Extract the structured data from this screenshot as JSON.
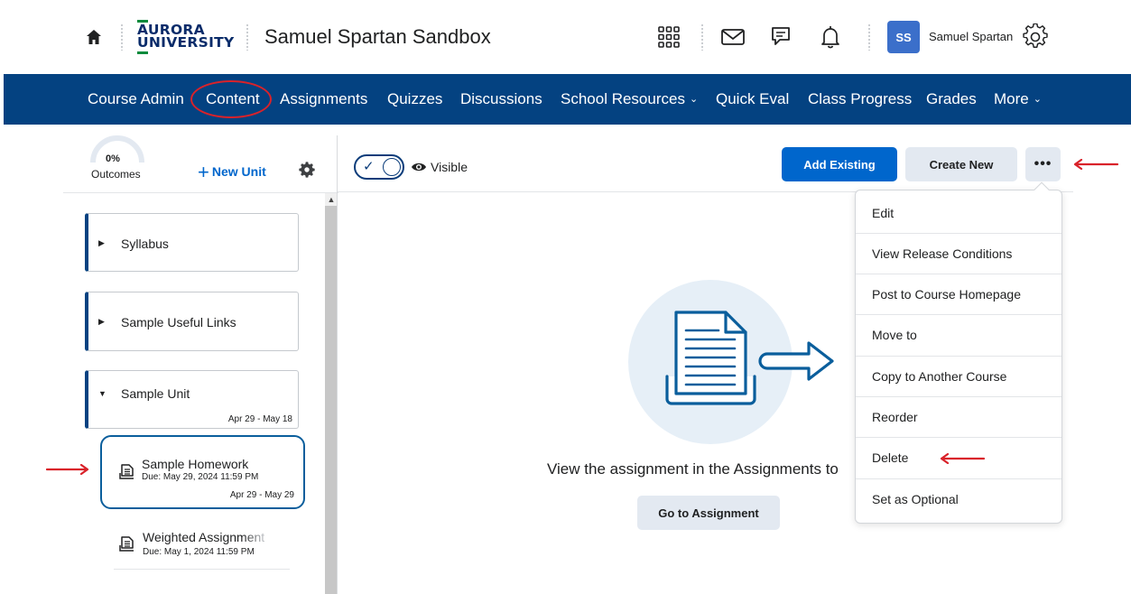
{
  "header": {
    "logo_line1": "AURORA",
    "logo_line2": "UNIVERSITY",
    "course_title": "Samuel Spartan Sandbox",
    "avatar_initials": "SS",
    "user_name": "Samuel Spartan"
  },
  "nav": {
    "items": [
      {
        "label": "Course Admin"
      },
      {
        "label": "Content"
      },
      {
        "label": "Assignments"
      },
      {
        "label": "Quizzes"
      },
      {
        "label": "Discussions"
      },
      {
        "label": "School Resources"
      },
      {
        "label": "Quick Eval"
      },
      {
        "label": "Class Progress"
      },
      {
        "label": "Grades"
      },
      {
        "label": "More"
      }
    ]
  },
  "sidebar": {
    "outcomes_percent": "0%",
    "outcomes_label": "Outcomes",
    "new_unit_label": "New Unit",
    "units": [
      {
        "title": "Syllabus",
        "dates": ""
      },
      {
        "title": "Sample Useful Links",
        "dates": ""
      },
      {
        "title": "Sample Unit",
        "dates": "Apr 29 - May 18"
      }
    ],
    "topics": [
      {
        "title": "Sample Homework",
        "due": "Due: May 29, 2024 11:59 PM",
        "dates": "Apr 29 - May 29"
      },
      {
        "title": "Weighted Assignment",
        "due": "Due: May 1, 2024 11:59 PM",
        "dates": ""
      }
    ]
  },
  "toolbar": {
    "visible_label": "Visible",
    "add_existing_label": "Add Existing",
    "create_new_label": "Create New",
    "more_label": "•••"
  },
  "main": {
    "empty_text": "View the assignment in the Assignments to",
    "goto_label": "Go to Assignment"
  },
  "menu": {
    "items": [
      "Edit",
      "View Release Conditions",
      "Post to Course Homepage",
      "Move to",
      "Copy to Another Course",
      "Reorder",
      "Delete",
      "Set as Optional"
    ]
  },
  "colors": {
    "nav_bg": "#044281",
    "primary": "#0066cc",
    "annotation_red": "#d9222a",
    "logo_navy": "#0a2c6a",
    "logo_green": "#0b8a3c"
  },
  "icons": [
    "home-icon",
    "app-grid-icon",
    "mail-icon",
    "chat-icon",
    "bell-icon",
    "gear-icon",
    "eye-icon",
    "document-icon",
    "chevron-down-icon"
  ]
}
